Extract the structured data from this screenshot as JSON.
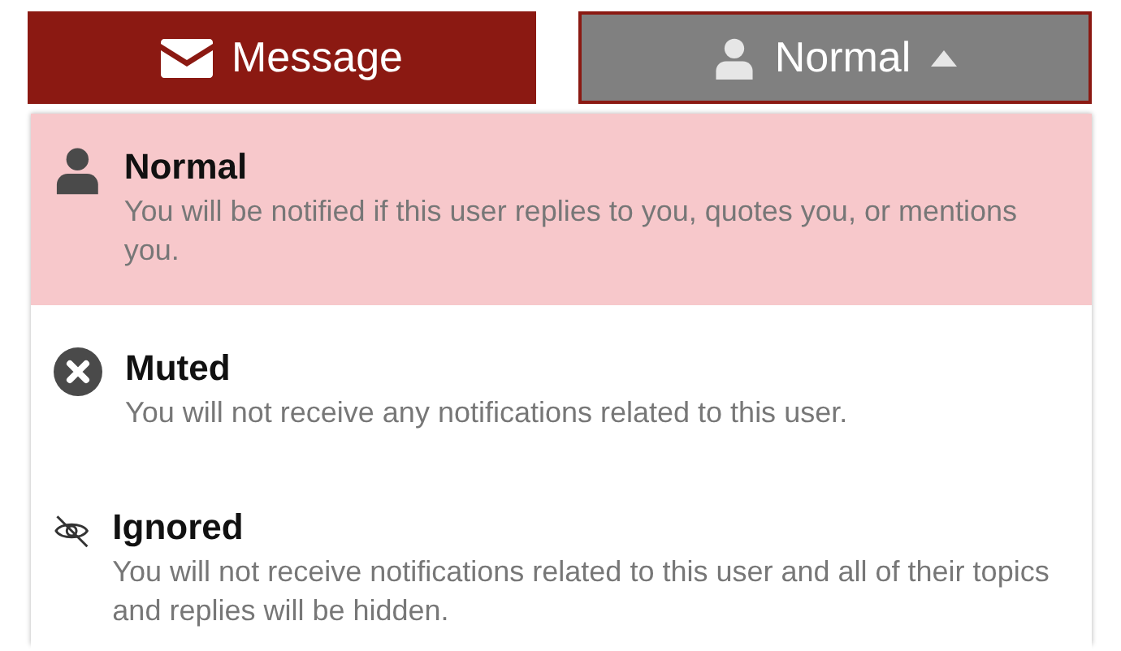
{
  "buttons": [
    {
      "kind": "message",
      "label": "Message"
    },
    {
      "kind": "level",
      "label": "Normal",
      "expanded": true
    }
  ],
  "menu": {
    "items": [
      {
        "kind": "normal",
        "title": "Normal",
        "description": "You will be notified if this user replies to you, quotes you, or mentions you.",
        "selected": true
      },
      {
        "kind": "muted",
        "title": "Muted",
        "description": "You will not receive any notifications related to this user.",
        "selected": false
      },
      {
        "kind": "ignored",
        "title": "Ignored",
        "description": "You will not receive notifications related to this user and all of their topics and replies will be hidden.",
        "selected": false
      }
    ]
  }
}
